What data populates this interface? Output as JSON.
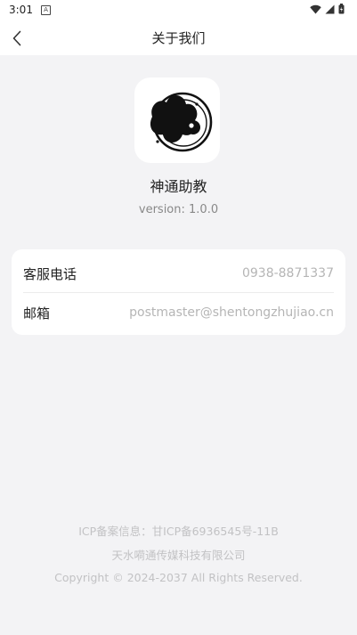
{
  "status_bar": {
    "time": "3:01",
    "app_icon_letter": "A"
  },
  "nav": {
    "title": "关于我们"
  },
  "app": {
    "name": "神通助教",
    "version": "version: 1.0.0"
  },
  "contact": {
    "phone_label": "客服电话",
    "phone_value": "0938-8871337",
    "email_label": "邮箱",
    "email_value": "postmaster@shentongzhujiao.cn"
  },
  "footer": {
    "icp": "ICP备案信息：甘ICP备6936545号-11B",
    "company": "天水嗬通传媒科技有限公司",
    "copyright": "Copyright © 2024-2037 All Rights Reserved."
  }
}
